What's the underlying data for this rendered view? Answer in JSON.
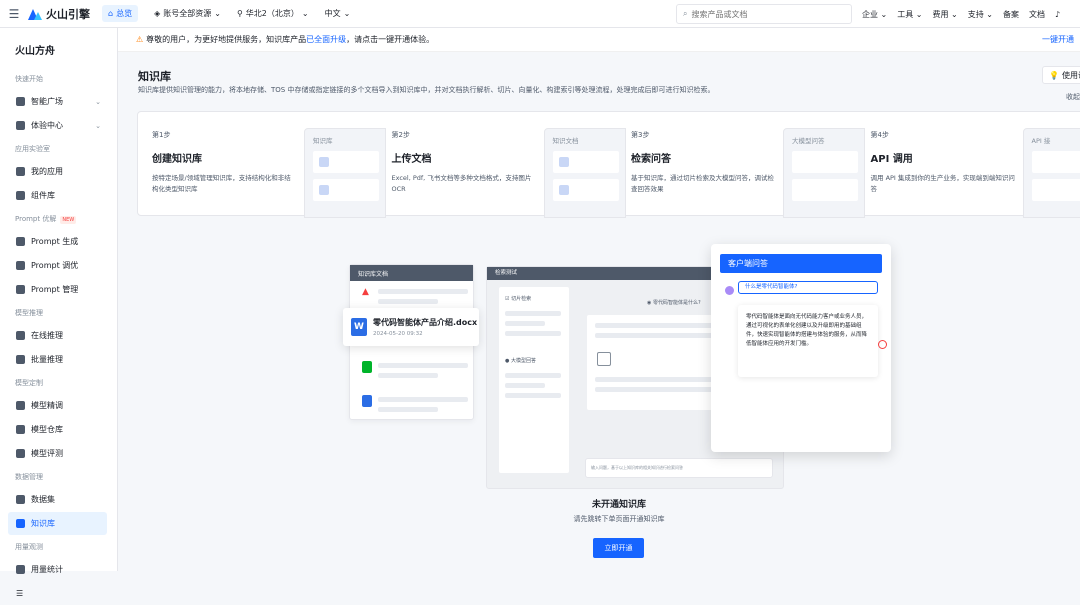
{
  "topbar": {
    "logo": "火山引擎",
    "overview": "总览",
    "account_resources": "账号全部资源",
    "region": "华北2（北京）",
    "language": "中文",
    "search_placeholder": "搜索产品或文档",
    "menu": [
      "企业",
      "工具",
      "费用",
      "支持",
      "备案",
      "文档"
    ]
  },
  "sidebar": {
    "title": "火山方舟",
    "groups": [
      {
        "label": "快速开始",
        "items": [
          {
            "label": "智能广场",
            "has_chevron": true
          },
          {
            "label": "体验中心",
            "has_chevron": true
          }
        ]
      },
      {
        "label": "应用实验室",
        "items": [
          {
            "label": "我的应用"
          },
          {
            "label": "组件库"
          }
        ]
      },
      {
        "label": "Prompt 优解",
        "badge": "NEW",
        "items": [
          {
            "label": "Prompt 生成"
          },
          {
            "label": "Prompt 调优"
          },
          {
            "label": "Prompt 管理"
          }
        ]
      },
      {
        "label": "模型推理",
        "items": [
          {
            "label": "在线推理"
          },
          {
            "label": "批量推理"
          }
        ]
      },
      {
        "label": "模型定制",
        "items": [
          {
            "label": "模型精调"
          },
          {
            "label": "模型仓库"
          },
          {
            "label": "模型评测"
          }
        ]
      },
      {
        "label": "数据管理",
        "items": [
          {
            "label": "数据集"
          },
          {
            "label": "知识库",
            "active": true
          }
        ]
      },
      {
        "label": "用量观测",
        "items": [
          {
            "label": "用量统计"
          }
        ]
      }
    ]
  },
  "notice": {
    "text_before": "尊敬的用户，为更好地提供服务，知识库产品",
    "link": "已全面升级",
    "text_after": "，请点击一键开通体验。",
    "action": "一键开通"
  },
  "page": {
    "title": "知识库",
    "description": "知识库提供知识管理的能力，将本地存储、TOS 中存储或指定链接的多个文档导入到知识库中，并对文档执行解析、切片、向量化、构建索引等处理流程，处理完成后即可进行知识检索。",
    "guide_button": "使用说",
    "guide_link": "收起"
  },
  "steps": [
    {
      "no": "第1步",
      "title": "创建知识库",
      "desc": "按特定场景/领域管理知识库，支持结构化和非结构化类型知识库",
      "ill_title": "知识库"
    },
    {
      "no": "第2步",
      "title": "上传文档",
      "desc": "Excel, Pdf, 飞书文档等多种文档格式，支持图片 OCR",
      "ill_title": "知识文档"
    },
    {
      "no": "第3步",
      "title": "检索问答",
      "desc": "基于知识库，通过切片检索及大模型问答，调试检查回答效果",
      "ill_title": "大模型问答"
    },
    {
      "no": "第4步",
      "title": "API 调用",
      "desc": "调用 API 集成到你的生产业务，实现端到端知识问答",
      "ill_title": "API 接"
    }
  ],
  "illustration": {
    "card_docs_title": "知识库文档",
    "doc_name": "零代码智能体产品介绍.docx",
    "doc_date": "2024-05-20 09:32",
    "card_test_title": "检索测试",
    "slice_label": "切片检索",
    "llm_label": "大模型回答",
    "question_bubble": "零代码智能体是什么?",
    "input_placeholder": "输入问题，基于以上知识库的相关知识进行检索问答",
    "client_title": "客户端问答",
    "client_question": "什么是零代码智能体?",
    "client_answer": "零代码智能体是面向无代码能力客户或业务人员，通过可视化的表单化创建以及升级即用的基础组件，快速实现智能体的搭建与体验的服务，从而降低智能体应用的开发门槛。"
  },
  "empty": {
    "title": "未开通知识库",
    "desc": "请先跳转下单页面开通知识库",
    "button": "立即开通"
  },
  "colors": {
    "accent": "#1664ff",
    "active_bg": "#e8f3ff"
  }
}
